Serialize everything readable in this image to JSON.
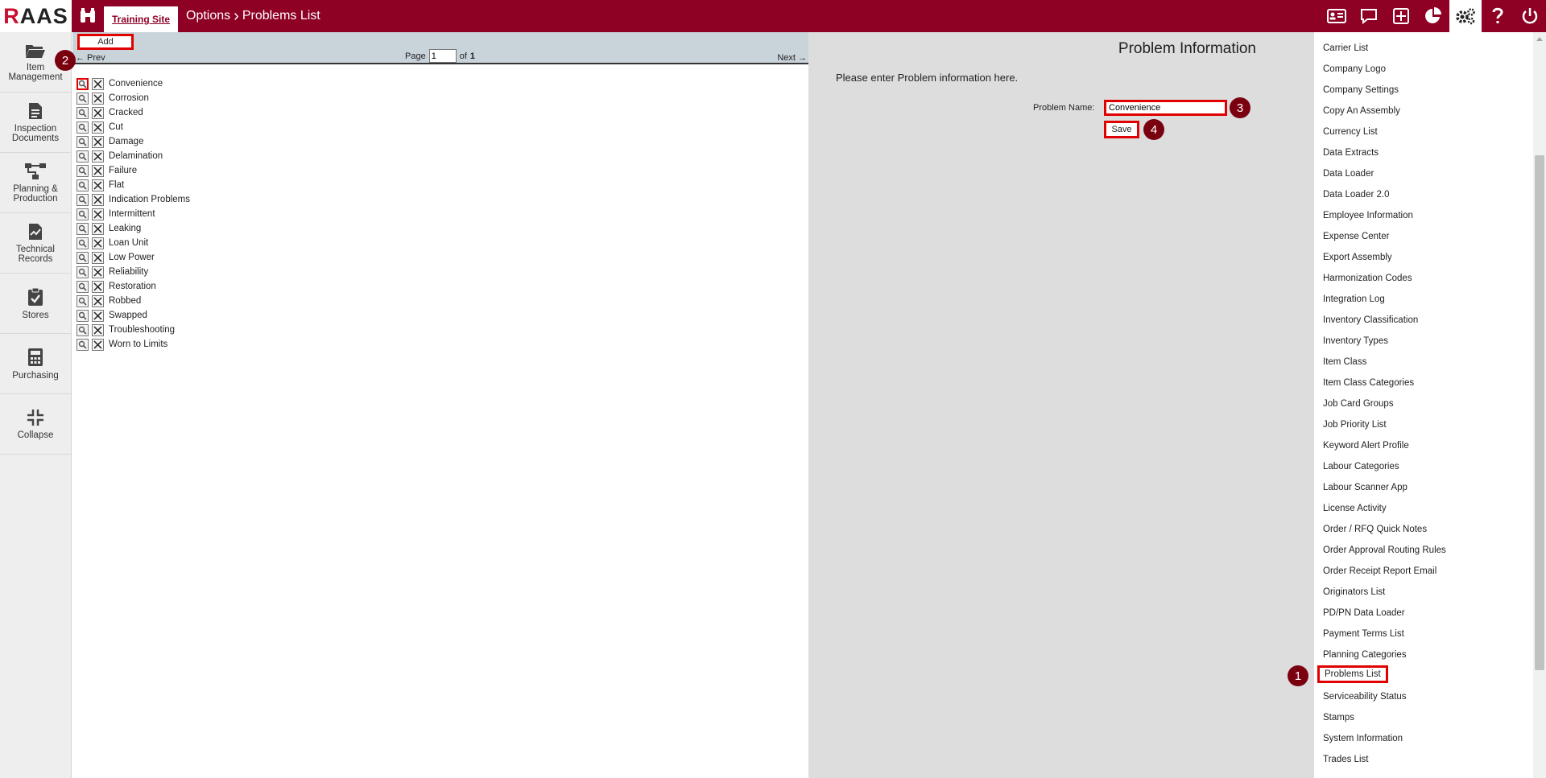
{
  "topbar": {
    "logo_r": "R",
    "logo_rest": "AAS",
    "site_tab": "Training Site",
    "crumb_1": "Options",
    "crumb_sep": "›",
    "crumb_2": "Problems List"
  },
  "sidebar": {
    "items": [
      {
        "label": "Item Management",
        "icon": "folder-icon"
      },
      {
        "label": "Inspection Documents",
        "icon": "document-icon"
      },
      {
        "label": "Planning & Production",
        "icon": "workflow-icon"
      },
      {
        "label": "Technical Records",
        "icon": "chart-document-icon"
      },
      {
        "label": "Stores",
        "icon": "clipboard-check-icon"
      },
      {
        "label": "Purchasing",
        "icon": "calculator-icon"
      },
      {
        "label": "Collapse",
        "icon": "collapse-icon"
      }
    ]
  },
  "list": {
    "add_label": "Add",
    "prev_label": "← Prev",
    "page_label": "Page",
    "page_value": "1",
    "of_label": "of",
    "total_pages": "1",
    "next_label": "Next →",
    "items": [
      "Convenience",
      "Corrosion",
      "Cracked",
      "Cut",
      "Damage",
      "Delamination",
      "Failure",
      "Flat",
      "Indication Problems",
      "Intermittent",
      "Leaking",
      "Loan Unit",
      "Low Power",
      "Reliability",
      "Restoration",
      "Robbed",
      "Swapped",
      "Troubleshooting",
      "Worn to Limits"
    ]
  },
  "form": {
    "title": "Problem Information",
    "intro": "Please enter Problem information here.",
    "name_label": "Problem Name:",
    "name_value": "Convenience",
    "save_label": "Save"
  },
  "options": {
    "items": [
      "Carrier List",
      "Company Logo",
      "Company Settings",
      "Copy An Assembly",
      "Currency List",
      "Data Extracts",
      "Data Loader",
      "Data Loader 2.0",
      "Employee Information",
      "Expense Center",
      "Export Assembly",
      "Harmonization Codes",
      "Integration Log",
      "Inventory Classification",
      "Inventory Types",
      "Item Class",
      "Item Class Categories",
      "Job Card Groups",
      "Job Priority List",
      "Keyword Alert Profile",
      "Labour Categories",
      "Labour Scanner App",
      "License Activity",
      "Order / RFQ Quick Notes",
      "Order Approval Routing Rules",
      "Order Receipt Report Email",
      "Originators List",
      "PD/PN Data Loader",
      "Payment Terms List",
      "Planning Categories",
      "Problems List",
      "Serviceability Status",
      "Stamps",
      "System Information",
      "Trades List"
    ],
    "selected": "Problems List"
  },
  "markers": [
    "1",
    "2",
    "3",
    "4"
  ],
  "colors": {
    "brand": "#8e0024",
    "highlight": "#e00000",
    "marker": "#7a0010"
  }
}
